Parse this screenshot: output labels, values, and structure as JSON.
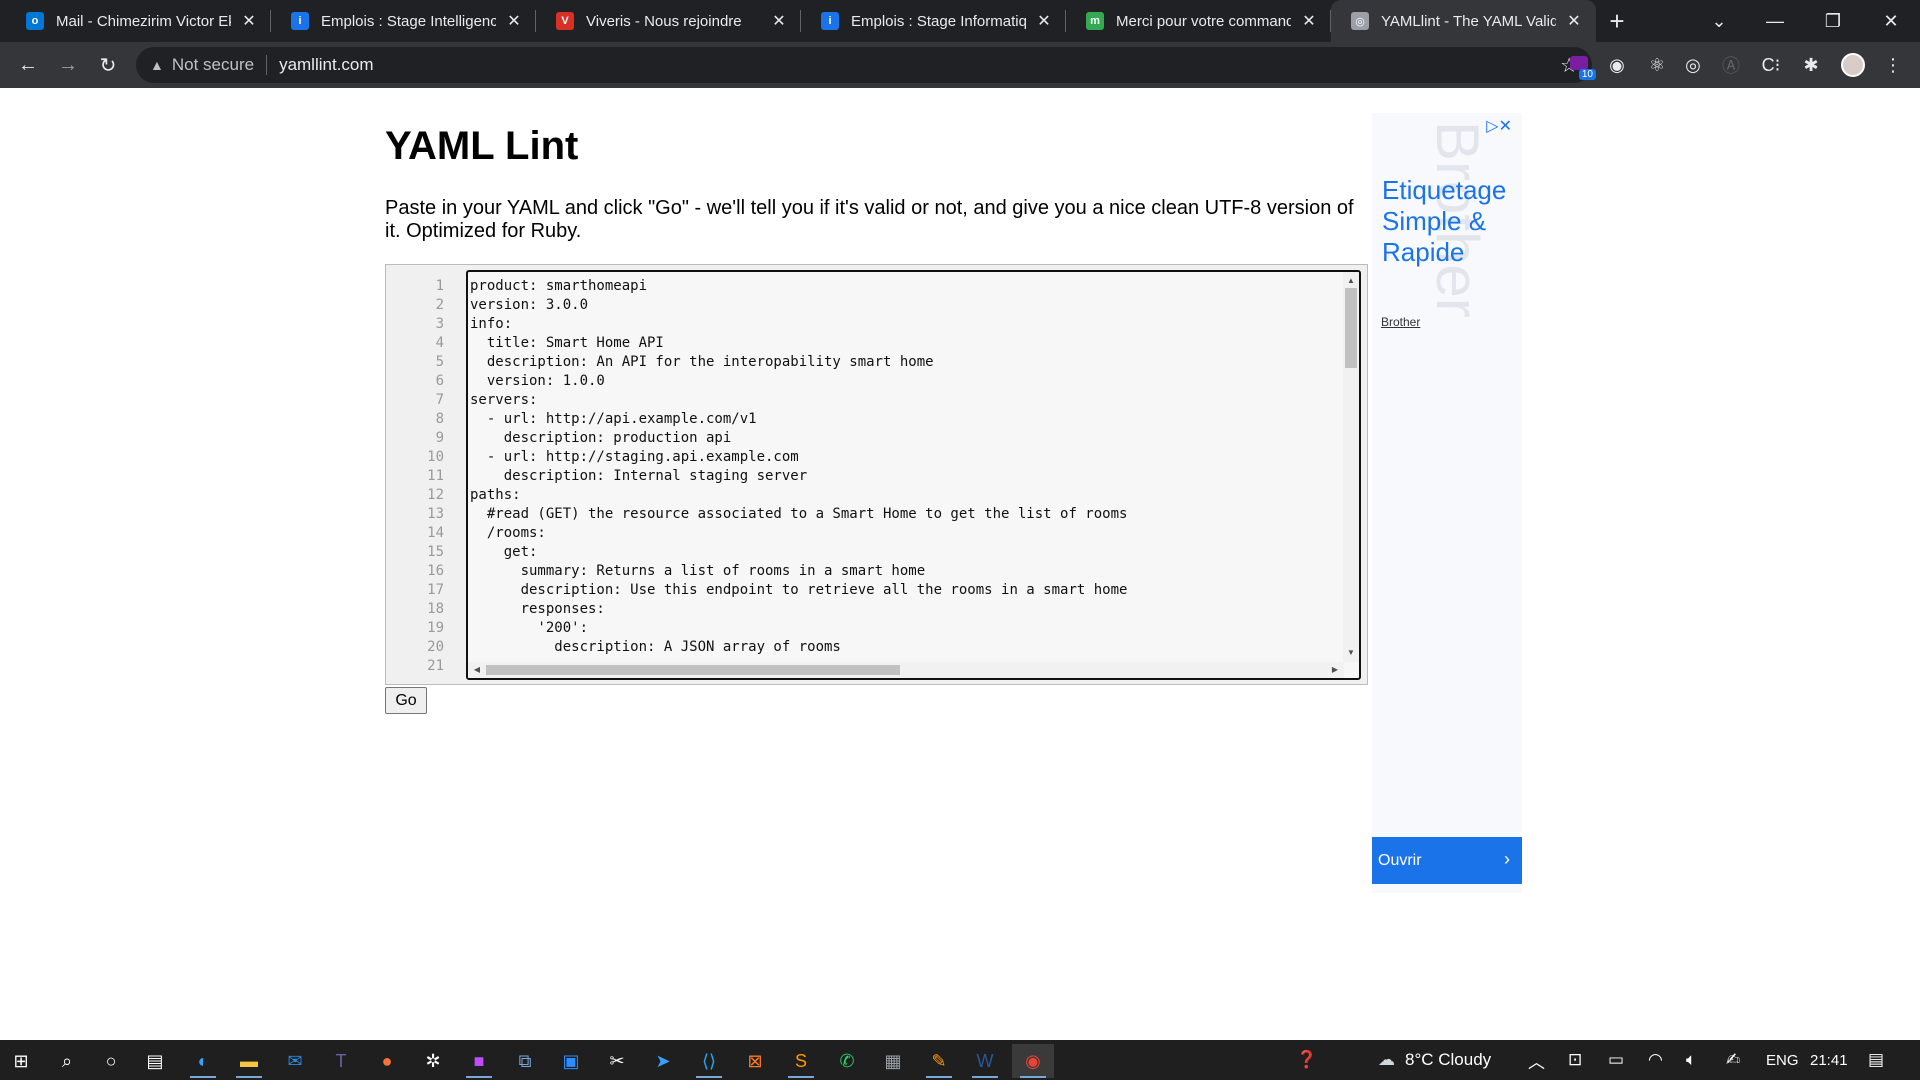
{
  "browser": {
    "tabs": [
      {
        "title": "Mail - Chimezirim Victor Ek",
        "favicon_color": "#0078d4",
        "favicon_glyph": "o",
        "active": false
      },
      {
        "title": "Emplois : Stage Intelligence",
        "favicon_color": "#1a73e8",
        "favicon_glyph": "i",
        "active": false
      },
      {
        "title": "Viveris - Nous rejoindre",
        "favicon_color": "#d93025",
        "favicon_glyph": "V",
        "active": false
      },
      {
        "title": "Emplois : Stage Informatiqu",
        "favicon_color": "#1a73e8",
        "favicon_glyph": "i",
        "active": false
      },
      {
        "title": "Merci pour votre command",
        "favicon_color": "#34a853",
        "favicon_glyph": "m",
        "active": false
      },
      {
        "title": "YAMLlint - The YAML Valida",
        "favicon_color": "#9aa0a6",
        "favicon_glyph": "◎",
        "active": true
      }
    ],
    "new_tab": "+",
    "security_label": "Not secure",
    "url": "yamllint.com",
    "extension_badge": "10"
  },
  "page": {
    "title": "YAML Lint",
    "intro": "Paste in your YAML and click \"Go\" - we'll tell you if it's valid or not, and give you a nice clean UTF-8 version of it. Optimized for Ruby.",
    "line_numbers": "1\n2\n3\n4\n5\n6\n7\n8\n9\n10\n11\n12\n13\n14\n15\n16\n17\n18\n19\n20\n21",
    "yaml": "product: smarthomeapi\nversion: 3.0.0\ninfo:\n  title: Smart Home API\n  description: An API for the interopability smart home\n  version: 1.0.0\nservers:\n  - url: http://api.example.com/v1\n    description: production api\n  - url: http://staging.api.example.com\n    description: Internal staging server\npaths:\n  #read (GET) the resource associated to a Smart Home to get the list of rooms\n  /rooms:\n    get:\n      summary: Returns a list of rooms in a smart home\n      description: Use this endpoint to retrieve all the rooms in a smart home\n      responses:\n        '200':\n          description: A JSON array of rooms",
    "go_label": "Go"
  },
  "ad": {
    "watermark": "Brother",
    "headline": "Etiquetage Simple & Rapide",
    "brand": "Brother",
    "cta": "Ouvrir"
  },
  "taskbar": {
    "weather": "8°C  Cloudy",
    "language": "ENG",
    "time": "21:41"
  }
}
